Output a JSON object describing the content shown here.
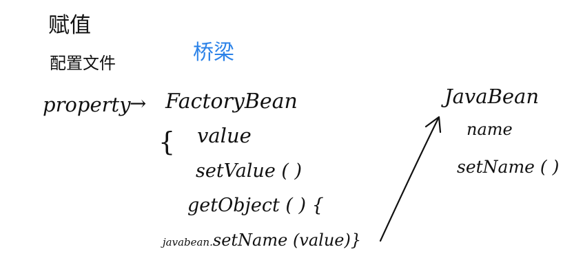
{
  "notes": {
    "assign": "赋值",
    "config_file": "配置文件",
    "bridge": "桥梁",
    "property": "property",
    "arrow": "→",
    "factory_bean": "FactoryBean",
    "brace": "{",
    "value": "value",
    "set_value": "setValue ( )",
    "get_object": "getObject ( ) {",
    "set_call_object": "javabean.",
    "set_call_method": "setName (value)}",
    "java_bean": "JavaBean",
    "name": "name",
    "set_name": "setName ( )"
  },
  "colors": {
    "ink": "#111111",
    "bridge": "#2b82e8"
  }
}
